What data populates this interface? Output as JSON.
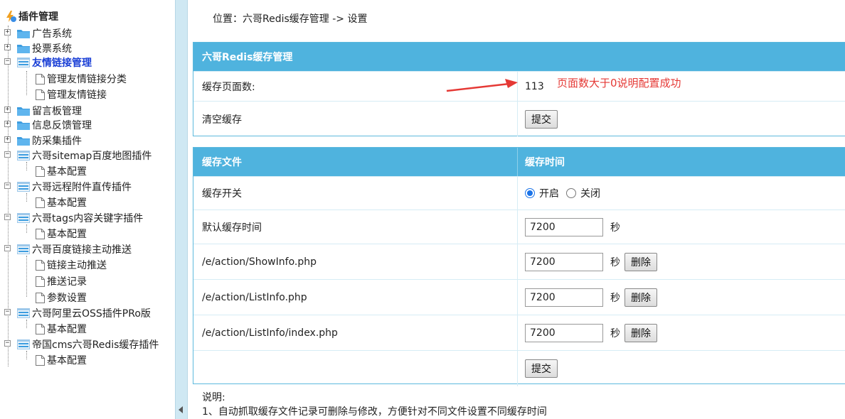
{
  "sidebar": {
    "root": "插件管理",
    "items": [
      {
        "label": "广告系统"
      },
      {
        "label": "投票系统"
      },
      {
        "label": "友情链接管理"
      },
      {
        "label": "管理友情链接分类"
      },
      {
        "label": "管理友情链接"
      },
      {
        "label": "留言板管理"
      },
      {
        "label": "信息反馈管理"
      },
      {
        "label": "防采集插件"
      },
      {
        "label": "六哥sitemap百度地图插件"
      },
      {
        "label": "基本配置"
      },
      {
        "label": "六哥远程附件直传插件"
      },
      {
        "label": "基本配置"
      },
      {
        "label": "六哥tags内容关键字插件"
      },
      {
        "label": "基本配置"
      },
      {
        "label": "六哥百度链接主动推送"
      },
      {
        "label": "链接主动推送"
      },
      {
        "label": "推送记录"
      },
      {
        "label": "参数设置"
      },
      {
        "label": "六哥阿里云OSS插件PRo版"
      },
      {
        "label": "基本配置"
      },
      {
        "label": "帝国cms六哥Redis缓存插件"
      },
      {
        "label": "基本配置"
      }
    ]
  },
  "breadcrumb": "位置：六哥Redis缓存管理 -> 设置",
  "panel1": {
    "title": "六哥Redis缓存管理",
    "count_label": "缓存页面数:",
    "count_value": "113",
    "annotation": "页面数大于0说明配置成功",
    "clear_label": "清空缓存",
    "submit": "提交"
  },
  "panel2": {
    "col1": "缓存文件",
    "col2": "缓存时间",
    "switch_label": "缓存开关",
    "on": "开启",
    "off": "关闭",
    "default_label": "默认缓存时间",
    "default_value": "7200",
    "unit": "秒",
    "delete": "删除",
    "files": [
      {
        "path": "/e/action/ShowInfo.php",
        "value": "7200"
      },
      {
        "path": "/e/action/ListInfo.php",
        "value": "7200"
      },
      {
        "path": "/e/action/ListInfo/index.php",
        "value": "7200"
      }
    ],
    "submit": "提交"
  },
  "note": {
    "title": "说明:",
    "line1": "1、自动抓取缓存文件记录可删除与修改，方便针对不同文件设置不同缓存时间"
  },
  "colors": {
    "header": "#4fb3de",
    "border": "#5db9dd",
    "annotation": "#e53935",
    "active": "#1a3fd6"
  }
}
